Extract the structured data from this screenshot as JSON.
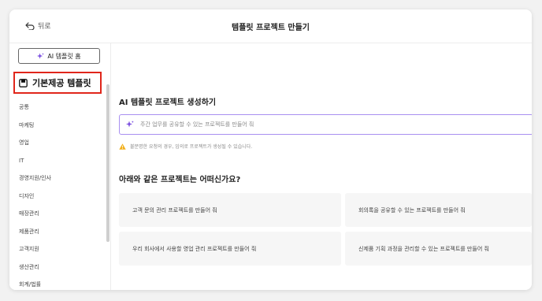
{
  "header": {
    "back_label": "뒤로",
    "title": "템플릿 프로젝트 만들기"
  },
  "sidebar": {
    "ai_home_label": "AI 템플릿 홈",
    "section_label": "기본제공 템플릿",
    "categories": [
      "공통",
      "마케팅",
      "영업",
      "IT",
      "경영지원/인사",
      "디자인",
      "매장관리",
      "제품관리",
      "고객지원",
      "생산관리",
      "회계/법률"
    ]
  },
  "main": {
    "generate_title": "AI 템플릿 프로젝트 생성하기",
    "prompt_placeholder": "주간 업무를 공유할 수 있는 프로젝트를 만들어 줘",
    "warning_text": "불분명한 요청의 경우, 임의로 프로젝트가 생성될 수 있습니다.",
    "suggest_title": "아래와 같은 프로젝트는 어떠신가요?",
    "suggestions": [
      "고객 문의 관리 프로젝트를 만들어 줘",
      "회의록을 공유할 수 있는 프로젝트를 만들어 줘",
      "우리 회사에서 사용할 영업 관리 프로젝트를 만들어 줘",
      "신제품 기획 과정을 관리할 수 있는 프로젝트를 만들어 줘"
    ]
  },
  "colors": {
    "highlight_border": "#e0261b",
    "prompt_border": "#a98ff0",
    "sparkle": "#7b4fe0",
    "warning": "#f2b01e"
  },
  "icons": {
    "back": "back-arrow-icon",
    "sparkle": "sparkle-icon",
    "template": "template-icon",
    "warning": "warning-icon"
  }
}
